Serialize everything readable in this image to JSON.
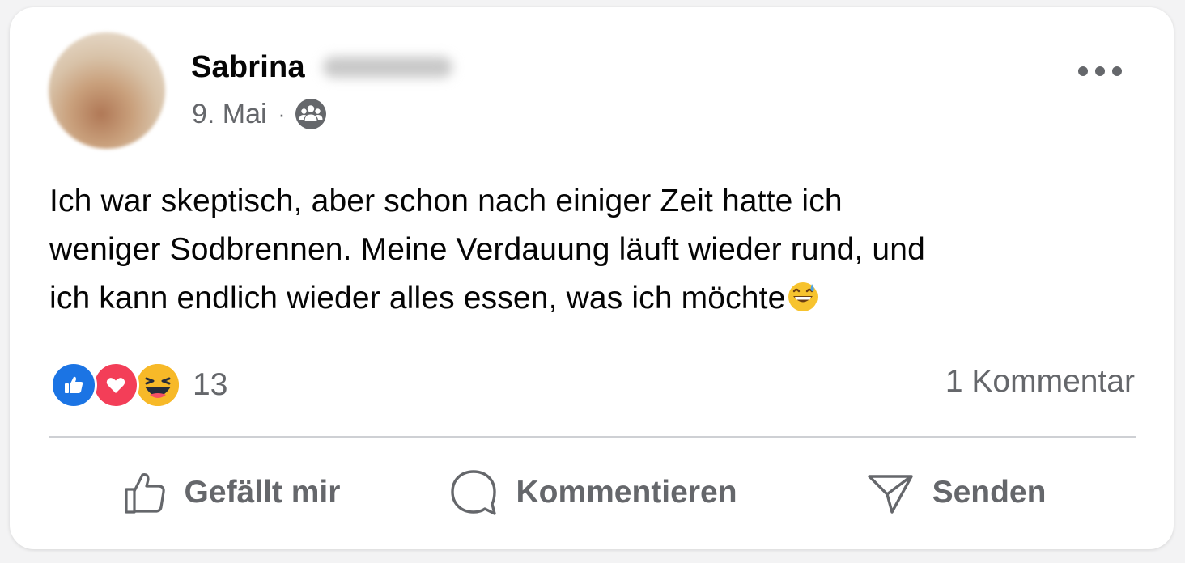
{
  "post": {
    "author": "Sabrina",
    "date": "9. Mai",
    "separator": "·",
    "audience_icon": "friends-icon",
    "text_lines": [
      "Ich war skeptisch, aber schon nach einiger Zeit hatte ich",
      "weniger Sodbrennen. Meine Verdauung läuft wieder rund, und",
      "ich kann endlich wieder alles essen, was ich möchte"
    ],
    "text_emoji": "grinning-face-with-sweat-emoji"
  },
  "reactions": {
    "types": [
      "like",
      "love",
      "haha"
    ],
    "count": "13"
  },
  "comments": {
    "label": "1 Kommentar"
  },
  "actions": {
    "like_label": "Gefällt mir",
    "comment_label": "Kommentieren",
    "send_label": "Senden"
  },
  "colors": {
    "like_blue": "#1b74e4",
    "love_red": "#f33e58",
    "haha_yellow": "#f7b928",
    "secondary_text": "#65676b",
    "primary_text": "#050505"
  }
}
